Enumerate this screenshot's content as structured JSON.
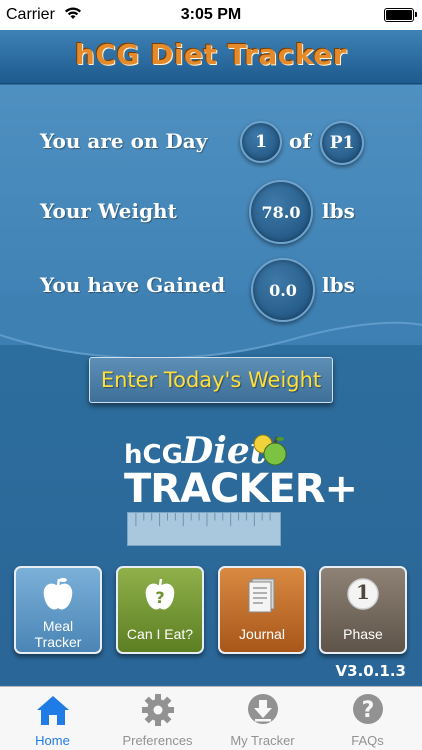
{
  "status_bar": {
    "carrier": "Carrier",
    "time": "3:05 PM"
  },
  "header": {
    "title": "hCG Diet Tracker"
  },
  "stats": {
    "day_label": "You are on Day",
    "day_value": "1",
    "of_label": "of",
    "phase_value": "P1",
    "weight_label": "Your Weight",
    "weight_value": "78.0",
    "weight_unit": "lbs",
    "gained_label": "You have Gained",
    "gained_value": "0.0",
    "gained_unit": "lbs"
  },
  "enter_weight_button": "Enter Today's Weight",
  "logo": {
    "line1": "hCG",
    "line2": "Diet",
    "line3": "TRACKER+"
  },
  "features": [
    {
      "label_line1": "Meal",
      "label_line2": "Tracker",
      "icon": "apple-icon"
    },
    {
      "label_line1": "Can I Eat?",
      "label_line2": "",
      "icon": "apple-question-icon"
    },
    {
      "label_line1": "Journal",
      "label_line2": "",
      "icon": "journal-icon"
    },
    {
      "label_line1": "Phase",
      "label_line2": "",
      "icon": "phase-number-icon"
    }
  ],
  "phase_icon_number": "1",
  "version": "V3.0.1.3",
  "tabs": [
    {
      "label": "Home",
      "icon": "home-icon",
      "active": true
    },
    {
      "label": "Preferences",
      "icon": "gear-icon",
      "active": false
    },
    {
      "label": "My Tracker",
      "icon": "download-icon",
      "active": false
    },
    {
      "label": "FAQs",
      "icon": "question-icon",
      "active": false
    }
  ],
  "colors": {
    "title_orange": "#e58a2a",
    "button_text_yellow": "#ffdf3a",
    "tab_active_blue": "#1f7be6",
    "tab_inactive_gray": "#929292"
  }
}
